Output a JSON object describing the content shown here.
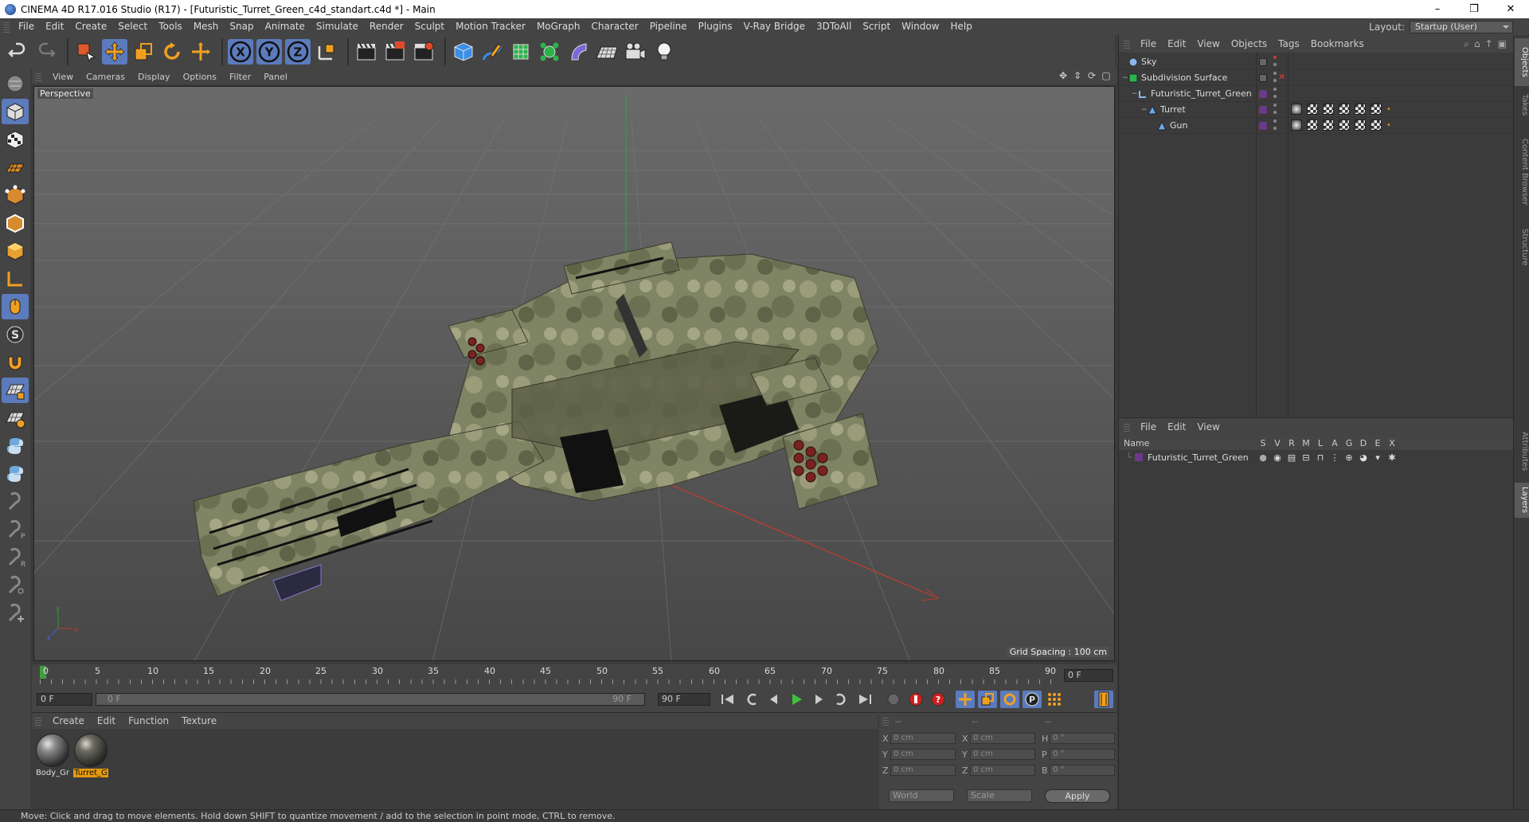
{
  "window": {
    "title": "CINEMA 4D R17.016 Studio (R17) - [Futuristic_Turret_Green_c4d_standart.c4d *] - Main",
    "buttons": {
      "minimize": "–",
      "restore": "❐",
      "close": "✕"
    }
  },
  "menubar": {
    "items": [
      "File",
      "Edit",
      "Create",
      "Select",
      "Tools",
      "Mesh",
      "Snap",
      "Animate",
      "Simulate",
      "Render",
      "Sculpt",
      "Motion Tracker",
      "MoGraph",
      "Character",
      "Pipeline",
      "Plugins",
      "V-Ray Bridge",
      "3DToAll",
      "Script",
      "Window",
      "Help"
    ],
    "layout_label": "Layout:",
    "layout_value": "Startup (User)"
  },
  "toolbar": {
    "axis_x": "X",
    "axis_y": "Y",
    "axis_z": "Z"
  },
  "viewport": {
    "menu": [
      "View",
      "Cameras",
      "Display",
      "Options",
      "Filter",
      "Panel"
    ],
    "camera_label": "Perspective",
    "grid_spacing": "Grid Spacing : 100 cm"
  },
  "timeline": {
    "ticks": [
      "0",
      "5",
      "10",
      "15",
      "20",
      "25",
      "30",
      "35",
      "40",
      "45",
      "50",
      "55",
      "60",
      "65",
      "70",
      "75",
      "80",
      "85",
      "90"
    ],
    "current_frame": "0 F",
    "start_frame": "0 F",
    "range_start": "0 F",
    "range_end": "90 F",
    "end_frame": "90 F"
  },
  "materials": {
    "menu": [
      "Create",
      "Edit",
      "Function",
      "Texture"
    ],
    "items": [
      {
        "name": "Body_Gr",
        "selected": false
      },
      {
        "name": "Turret_G",
        "selected": true
      }
    ]
  },
  "coordinates": {
    "head": [
      "--",
      "--",
      "--"
    ],
    "rows": [
      {
        "a1": "X",
        "v1": "0 cm",
        "a2": "X",
        "v2": "0 cm",
        "a3": "H",
        "v3": "0 °"
      },
      {
        "a1": "Y",
        "v1": "0 cm",
        "a2": "Y",
        "v2": "0 cm",
        "a3": "P",
        "v3": "0 °"
      },
      {
        "a1": "Z",
        "v1": "0 cm",
        "a2": "Z",
        "v2": "0 cm",
        "a3": "B",
        "v3": "0 °"
      }
    ],
    "space": "World",
    "mode": "Scale",
    "apply": "Apply"
  },
  "object_manager": {
    "menu": [
      "File",
      "Edit",
      "View",
      "Objects",
      "Tags",
      "Bookmarks"
    ],
    "objects": [
      {
        "name": "Sky",
        "indent": 0
      },
      {
        "name": "Subdivision Surface",
        "indent": 0
      },
      {
        "name": "Futuristic_Turret_Green",
        "indent": 1
      },
      {
        "name": "Turret",
        "indent": 2
      },
      {
        "name": "Gun",
        "indent": 3
      }
    ]
  },
  "layer_manager": {
    "menu": [
      "File",
      "Edit",
      "View"
    ],
    "columns": [
      "Name",
      "S",
      "V",
      "R",
      "M",
      "L",
      "A",
      "G",
      "D",
      "E",
      "X"
    ],
    "layers": [
      {
        "name": "Futuristic_Turret_Green"
      }
    ]
  },
  "side_tabs": [
    "Objects",
    "Takes",
    "Content Browser",
    "Structure",
    "Attributes",
    "Layers"
  ],
  "status": "Move: Click and drag to move elements. Hold down SHIFT to quantize movement / add to the selection in point mode, CTRL to remove.",
  "colors": {
    "accent": "#5b7bbd",
    "material_selected": "#e59a10",
    "playhead": "#3fa040",
    "layer_color": "#6b3a8a"
  }
}
